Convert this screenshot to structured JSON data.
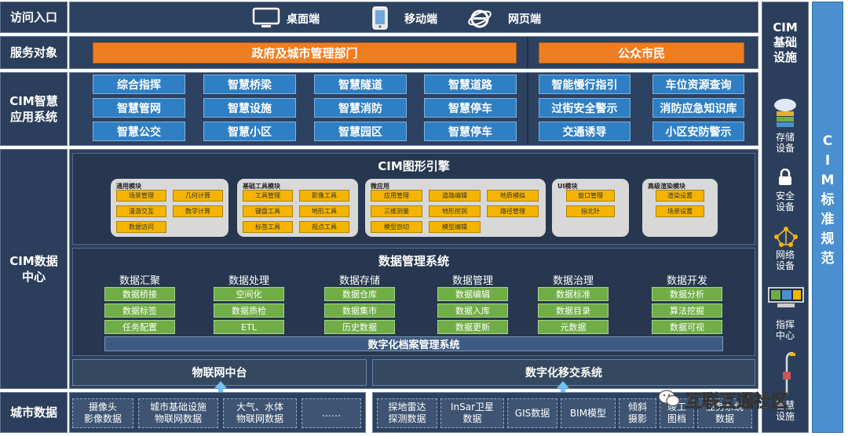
{
  "rows": {
    "access": "访问入口",
    "service": "服务对象",
    "apps": "CIM智慧\n应用系统",
    "data_center": "CIM数据\n中心",
    "city_data": "城市数据"
  },
  "access_items": [
    {
      "label": "桌面端",
      "icon": "monitor-icon"
    },
    {
      "label": "移动端",
      "icon": "mobile-icon"
    },
    {
      "label": "网页端",
      "icon": "browser-icon"
    }
  ],
  "service_targets": [
    "政府及城市管理部门",
    "公众市民"
  ],
  "gov_apps": [
    "综合指挥",
    "智慧桥梁",
    "智慧隧道",
    "智慧道路",
    "智慧管网",
    "智慧设施",
    "智慧消防",
    "智慧停车",
    "智慧公交",
    "智慧小区",
    "智慧园区",
    "智慧停车"
  ],
  "public_apps": [
    "智能慢行指引",
    "车位资源查询",
    "过街安全警示",
    "消防应急知识库",
    "交通诱导",
    "小区安防警示"
  ],
  "engine": {
    "title": "CIM图形引擎",
    "modules": [
      {
        "title": "通用模块",
        "items": [
          "场景管理",
          "几何计算",
          "漫游交互",
          "数学计算",
          "数据访问"
        ]
      },
      {
        "title": "基础工具模块",
        "items": [
          "工具管理",
          "影像工具",
          "键盘工具",
          "地形工具",
          "标签工具",
          "视点工具"
        ]
      },
      {
        "title": "微应用",
        "items": [
          "应用管理",
          "道路编辑",
          "地质模拟",
          "三维测量",
          "地形挖洞",
          "路径管理",
          "模型剖切",
          "模型编辑"
        ]
      },
      {
        "title": "UI模块",
        "items": [
          "窗口管理",
          "指北针"
        ]
      },
      {
        "title": "高级渲染模块",
        "items": [
          "渲染设置",
          "场景设置"
        ]
      }
    ]
  },
  "data_mgmt": {
    "title": "数据管理系统",
    "groups": [
      {
        "title": "数据汇聚",
        "items": [
          "数据桥接",
          "数据标签",
          "任务配置"
        ]
      },
      {
        "title": "数据处理",
        "items": [
          "空间化",
          "数据质检",
          "ETL"
        ]
      },
      {
        "title": "数据存储",
        "items": [
          "数据仓库",
          "数据集市",
          "历史数据"
        ]
      },
      {
        "title": "数据管理",
        "items": [
          "数据编辑",
          "数据入库",
          "数据更新"
        ]
      },
      {
        "title": "数据治理",
        "items": [
          "数据标准",
          "数据目录",
          "元数据"
        ]
      },
      {
        "title": "数据开发",
        "items": [
          "数据分析",
          "算法挖掘",
          "数据可视"
        ]
      }
    ],
    "archive": "数字化档案管理系统"
  },
  "iot_platform": "物联网中台",
  "transfer_system": "数字化移交系统",
  "city_data_left": [
    "摄像头\n影像数据",
    "城市基础设施\n物联网数据",
    "大气、水体\n物联网数据",
    "……"
  ],
  "city_data_right": [
    "探地雷达\n探测数据",
    "InSar卫星\n数据",
    "GIS数据",
    "BIM模型",
    "倾斜\n摄影",
    "竣工\n图档",
    "业务系统\n数据"
  ],
  "infrastructure": {
    "title": "CIM\n基础\n设施",
    "items": [
      {
        "label": "存储\n设备",
        "icon": "cloud-storage-icon"
      },
      {
        "label": "安全\n设备",
        "icon": "lock-icon"
      },
      {
        "label": "网络\n设备",
        "icon": "network-icon"
      },
      {
        "label": "指挥\n中心",
        "icon": "command-center-icon"
      },
      {
        "label": "智慧\n设施",
        "icon": "streetlight-icon"
      }
    ]
  },
  "standard": [
    "C",
    "I",
    "M",
    "标",
    "准",
    "规",
    "范"
  ],
  "watermark": "互联互通社区",
  "colors": {
    "panel": "#2d4160",
    "orange": "#ef7d22",
    "blue": "#2f7fc4",
    "green": "#70ad47",
    "yellow": "#f5b400",
    "standard": "#4a90d0"
  }
}
